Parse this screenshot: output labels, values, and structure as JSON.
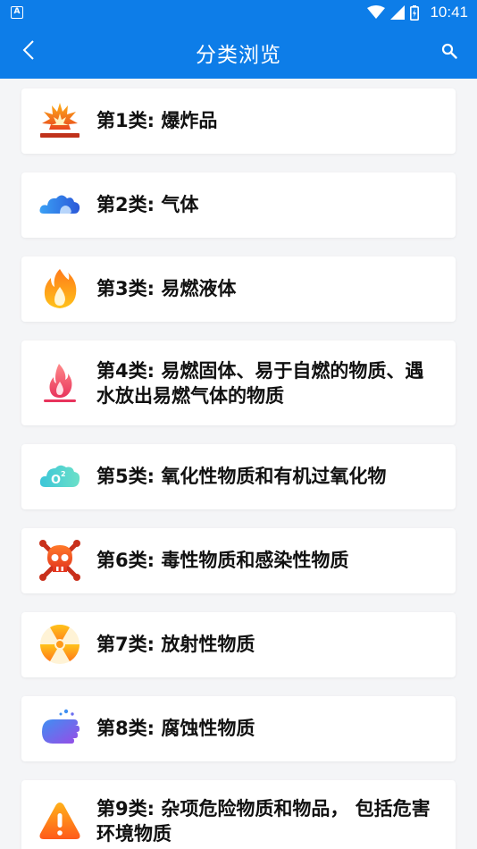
{
  "status_bar": {
    "time": "10:41",
    "app_badge": "A"
  },
  "app_bar": {
    "title": "分类浏览"
  },
  "categories": [
    {
      "label": "第1类: 爆炸品",
      "icon": "explosion-icon"
    },
    {
      "label": "第2类: 气体",
      "icon": "cloud-gas-icon"
    },
    {
      "label": "第3类: 易燃液体",
      "icon": "flame-icon"
    },
    {
      "label": "第4类: 易燃固体、易于自燃的物质、遇水放出易燃气体的物质",
      "icon": "burning-solid-icon"
    },
    {
      "label": "第5类: 氧化性物质和有机过氧化物",
      "icon": "oxygen-cloud-icon"
    },
    {
      "label": "第6类: 毒性物质和感染性物质",
      "icon": "skull-crossbones-icon"
    },
    {
      "label": "第7类: 放射性物质",
      "icon": "radiation-icon"
    },
    {
      "label": "第8类: 腐蚀性物质",
      "icon": "corrosion-hand-icon"
    },
    {
      "label": "第9类: 杂项危险物质和物品， 包括危害环境物质",
      "icon": "warning-triangle-icon"
    }
  ],
  "colors": {
    "primary": "#0d7de8",
    "background": "#f4f5f7",
    "card": "#ffffff"
  }
}
